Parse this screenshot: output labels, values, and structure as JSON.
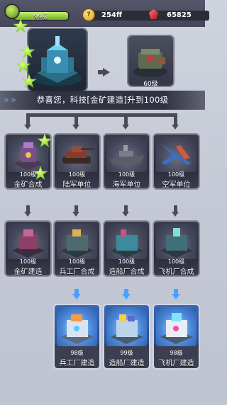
{
  "hud": {
    "level_label": "99级",
    "xp_fraction": 0.99,
    "gold_value": "254ff",
    "gold_icon_glyph": "?",
    "gem_value": "65825"
  },
  "upgrade": {
    "next_level_label": "60级",
    "message": "恭喜您，科技[金矿建造]升到100级"
  },
  "tier1": [
    {
      "name": "金矿合成",
      "level": "100级"
    },
    {
      "name": "陆军单位",
      "level": "100级"
    },
    {
      "name": "海军单位",
      "level": "100级"
    },
    {
      "name": "空军单位",
      "level": "100级"
    }
  ],
  "tier2": [
    {
      "name": "金矿建造",
      "level": "100级"
    },
    {
      "name": "兵工厂合成",
      "level": "100级"
    },
    {
      "name": "造船厂合成",
      "level": "100级"
    },
    {
      "name": "飞机厂合成",
      "level": "100级"
    }
  ],
  "tier3": [
    {
      "name": "兵工厂建造",
      "level": "98级"
    },
    {
      "name": "造船厂建造",
      "level": "99级"
    },
    {
      "name": "飞机厂建造",
      "level": "98级"
    }
  ],
  "colors": {
    "accent_green": "#8fd12a",
    "highlight_blue": "#4aa0ff",
    "connector": "#4a4b58"
  }
}
